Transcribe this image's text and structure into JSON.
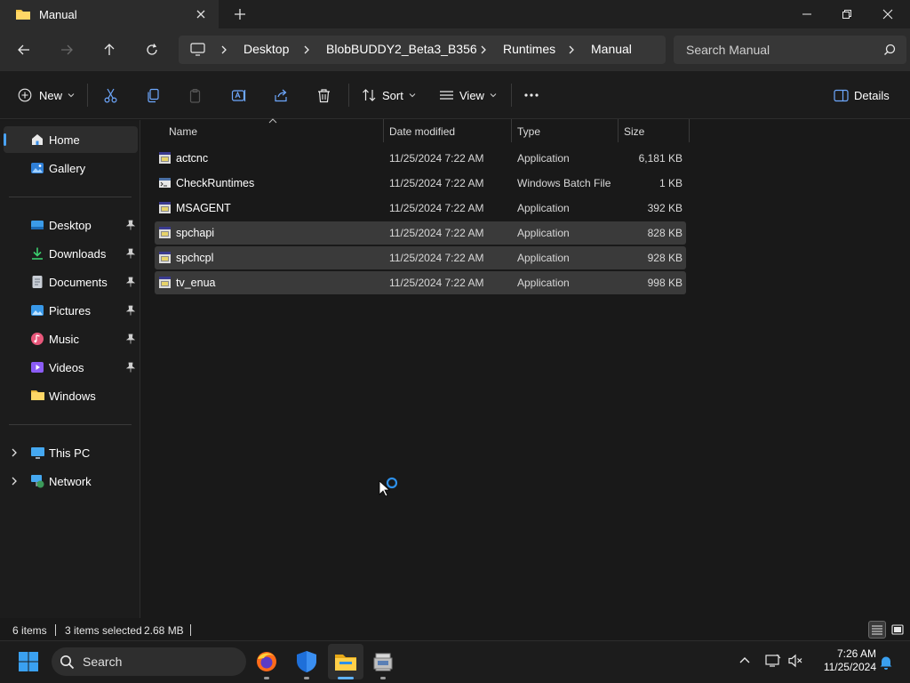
{
  "window": {
    "tab_title": "Manual",
    "controls": [
      "minimize-icon",
      "restore-icon",
      "close-icon"
    ]
  },
  "breadcrumb": [
    "Desktop",
    "BlobBUDDY2_Beta3_B356",
    "Runtimes",
    "Manual"
  ],
  "search": {
    "placeholder": "Search Manual"
  },
  "toolbar": {
    "new_label": "New",
    "sort_label": "Sort",
    "view_label": "View",
    "details_label": "Details"
  },
  "sidebar": {
    "top": [
      {
        "label": "Home",
        "icon": "home-icon"
      },
      {
        "label": "Gallery",
        "icon": "gallery-icon"
      }
    ],
    "quick": [
      {
        "label": "Desktop",
        "icon": "desktop-icon",
        "pinned": true
      },
      {
        "label": "Downloads",
        "icon": "downloads-icon",
        "pinned": true
      },
      {
        "label": "Documents",
        "icon": "documents-icon",
        "pinned": true
      },
      {
        "label": "Pictures",
        "icon": "pictures-icon",
        "pinned": true
      },
      {
        "label": "Music",
        "icon": "music-icon",
        "pinned": true
      },
      {
        "label": "Videos",
        "icon": "videos-icon",
        "pinned": true
      },
      {
        "label": "Windows",
        "icon": "folder-icon",
        "pinned": false
      }
    ],
    "tree": [
      {
        "label": "This PC",
        "icon": "this-pc-icon"
      },
      {
        "label": "Network",
        "icon": "network-icon"
      }
    ]
  },
  "columns": {
    "name": "Name",
    "date": "Date modified",
    "type": "Type",
    "size": "Size"
  },
  "files": [
    {
      "name": "actcnc",
      "date": "11/25/2024 7:22 AM",
      "type": "Application",
      "size": "6,181 KB",
      "selected": false,
      "icon": "application-icon"
    },
    {
      "name": "CheckRuntimes",
      "date": "11/25/2024 7:22 AM",
      "type": "Windows Batch File",
      "size": "1 KB",
      "selected": false,
      "icon": "batch-file-icon"
    },
    {
      "name": "MSAGENT",
      "date": "11/25/2024 7:22 AM",
      "type": "Application",
      "size": "392 KB",
      "selected": false,
      "icon": "application-icon"
    },
    {
      "name": "spchapi",
      "date": "11/25/2024 7:22 AM",
      "type": "Application",
      "size": "828 KB",
      "selected": true,
      "icon": "application-icon"
    },
    {
      "name": "spchcpl",
      "date": "11/25/2024 7:22 AM",
      "type": "Application",
      "size": "928 KB",
      "selected": true,
      "icon": "application-icon"
    },
    {
      "name": "tv_enua",
      "date": "11/25/2024 7:22 AM",
      "type": "Application",
      "size": "998 KB",
      "selected": true,
      "icon": "application-icon"
    }
  ],
  "status": {
    "item_count": "6 items",
    "selection": "3 items selected",
    "selection_size": "2.68 MB"
  },
  "taskbar": {
    "search_placeholder": "Search",
    "time": "7:26 AM",
    "date": "11/25/2024",
    "apps": [
      "start-icon",
      "firefox-icon",
      "security-icon",
      "file-explorer-icon",
      "installer-icon"
    ]
  },
  "colors": {
    "accent": "#0078d4",
    "selection": "#3a3a3a",
    "folder": "#f4c542"
  }
}
